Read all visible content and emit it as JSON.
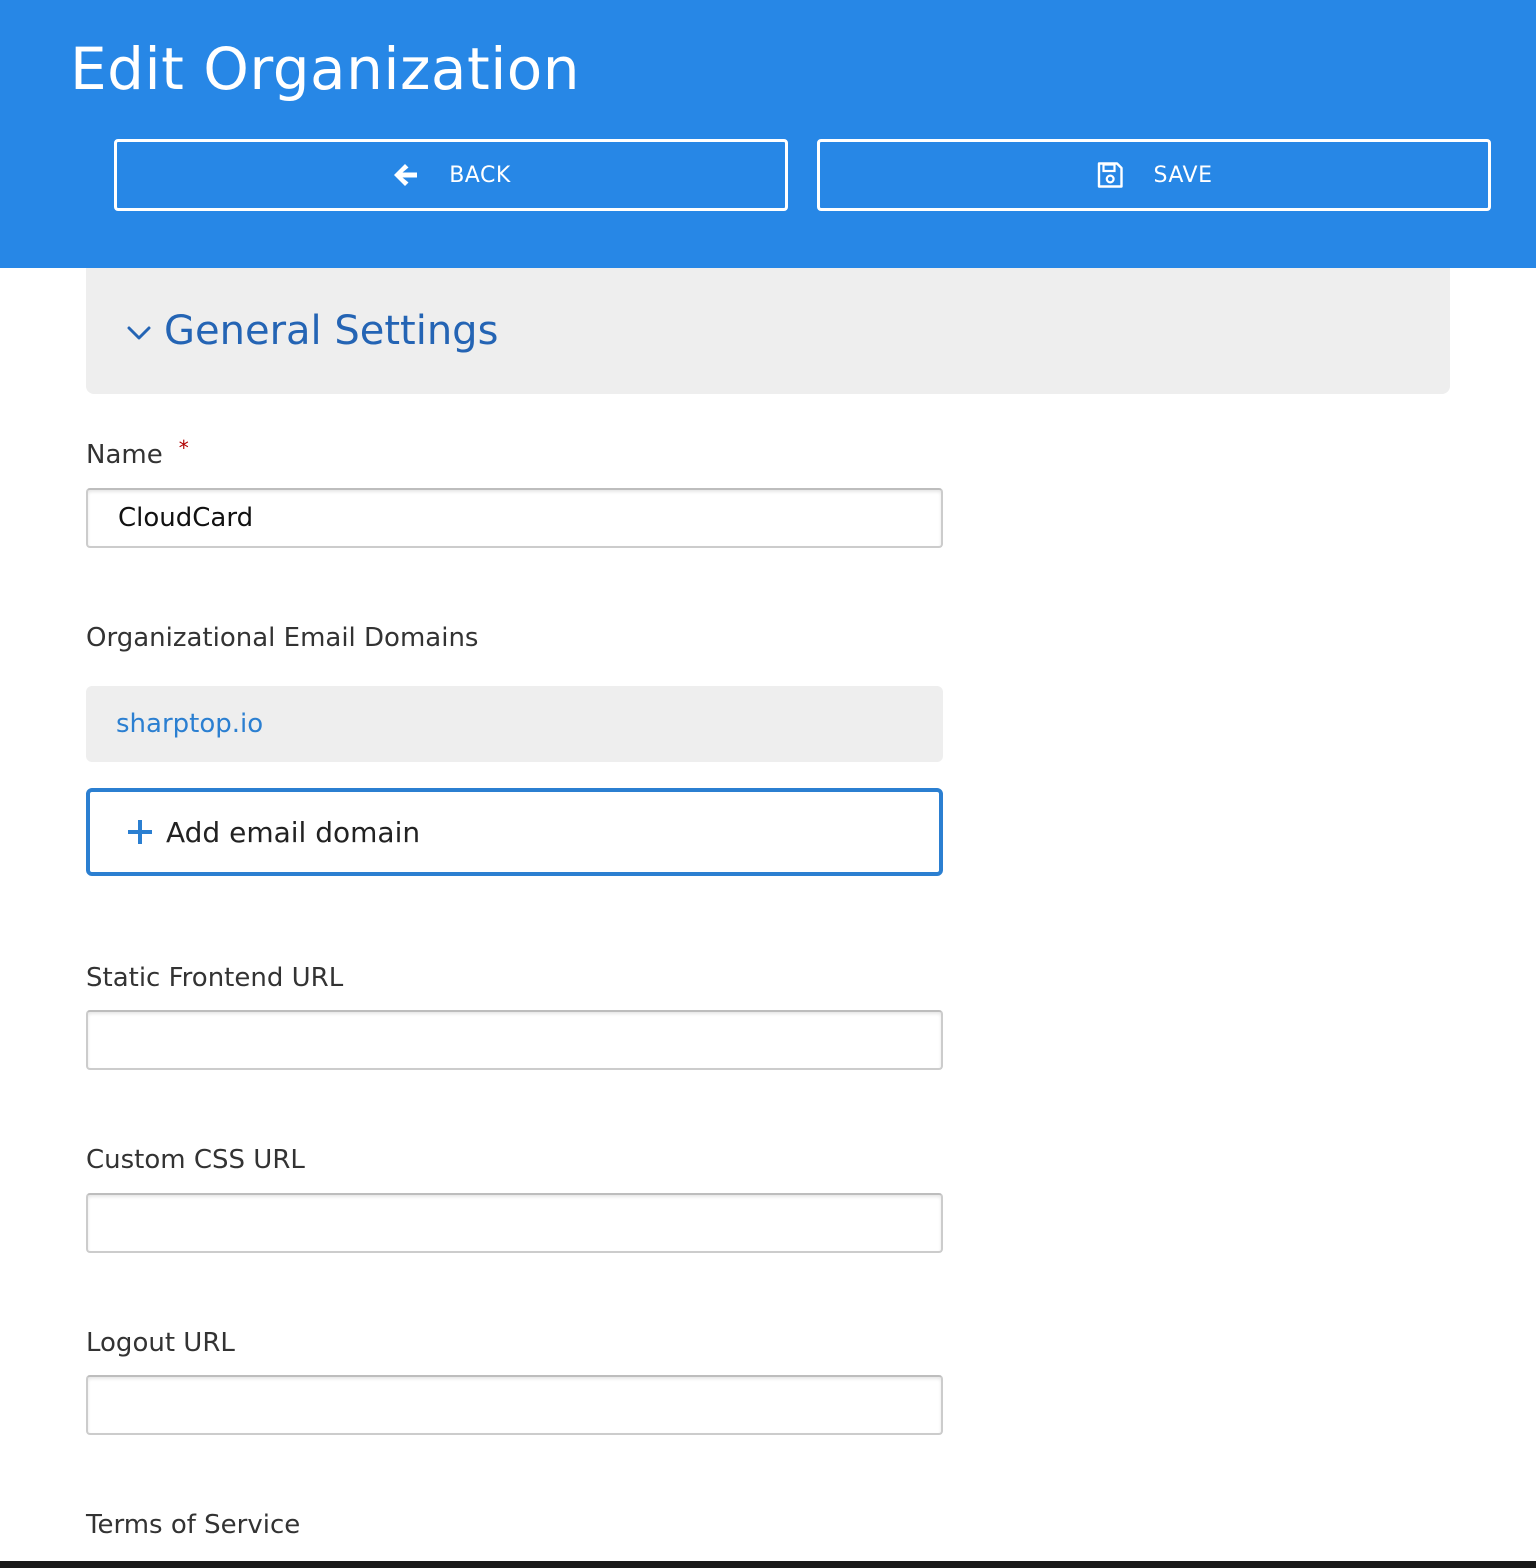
{
  "header": {
    "title": "Edit Organization",
    "back_label": "BACK",
    "save_label": "SAVE",
    "background_color": "#2787e6"
  },
  "section": {
    "title": "General Settings",
    "expanded": true
  },
  "form": {
    "name": {
      "label": "Name",
      "required_marker": "*",
      "value": "CloudCard"
    },
    "email_domains": {
      "label": "Organizational Email Domains",
      "items": [
        "sharptop.io"
      ],
      "add_label": "Add email domain"
    },
    "static_frontend_url": {
      "label": "Static Frontend URL",
      "value": ""
    },
    "custom_css_url": {
      "label": "Custom CSS URL",
      "value": ""
    },
    "logout_url": {
      "label": "Logout URL",
      "value": ""
    },
    "terms_of_service": {
      "label": "Terms of Service"
    }
  },
  "icons": {
    "back": "arrow-left-icon",
    "save": "floppy-disk-icon",
    "section_toggle": "chevron-down-icon",
    "add": "plus-icon"
  }
}
